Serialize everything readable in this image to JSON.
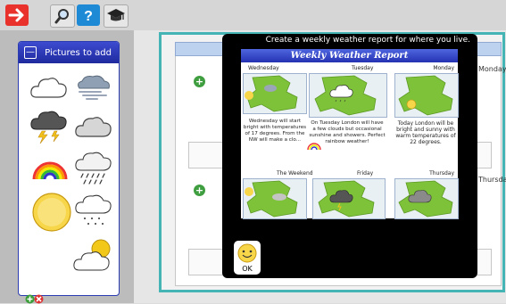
{
  "toolbar": {
    "buttons": [
      {
        "icon": "back-arrow-icon",
        "color": "#e8322b"
      },
      {
        "icon": "search-icon"
      },
      {
        "icon": "help-icon",
        "color": "#1e8ad6"
      },
      {
        "icon": "graduation-cap-icon"
      }
    ]
  },
  "pictures_panel": {
    "title": "Pictures to add",
    "collapse_label": "—",
    "items": [
      "cloud",
      "wind-cloud",
      "thunder-cloud",
      "cloud",
      "rainbow",
      "rain-cloud",
      "sun",
      "drizzle-cloud",
      "sun-cloud"
    ]
  },
  "background": {
    "days": [
      "Monday",
      "Thursday"
    ]
  },
  "modal": {
    "title": "Create a weekly weather report for where you live.",
    "report_title": "Weekly Weather Report",
    "days": [
      {
        "label": "Monday",
        "text": "Today London will be bright and sunny with warm temperatures of 22 degrees."
      },
      {
        "label": "Tuesday",
        "text": "On Tuesday London will have a few clouds but occasional sunshine and showers. Perfect rainbow weather!"
      },
      {
        "label": "Wednesday",
        "text": "Wednesday will start bright with temperatures of 17 degrees. From the NW will make a clo..."
      },
      {
        "label": "Thursday",
        "text": ""
      },
      {
        "label": "Friday",
        "text": ""
      },
      {
        "label": "The Weekend",
        "text": ""
      }
    ],
    "ok_label": "OK"
  },
  "colors": {
    "accent_blue": "#2532b2",
    "teal": "#44b4b4",
    "map_green": "#7ec23a"
  }
}
